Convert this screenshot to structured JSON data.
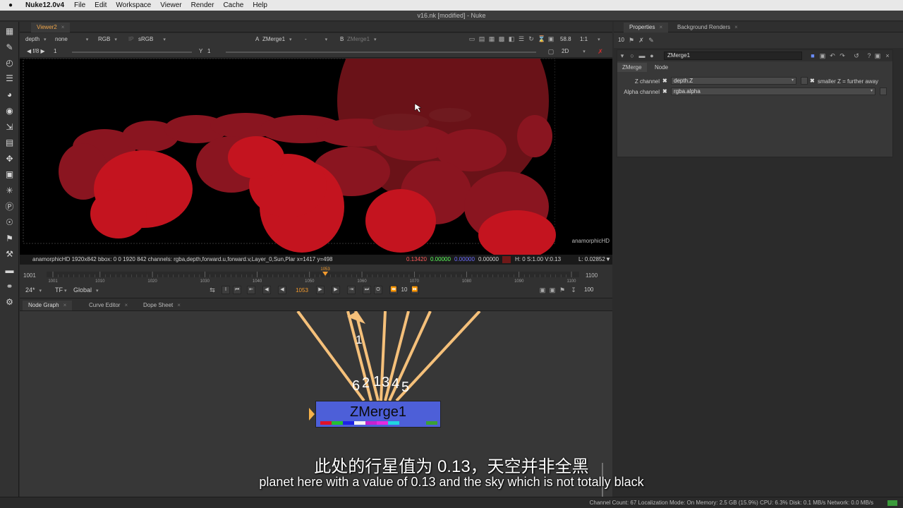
{
  "menubar": {
    "app": "Nuke12.0v4",
    "items": [
      "File",
      "Edit",
      "Workspace",
      "Viewer",
      "Render",
      "Cache",
      "Help"
    ]
  },
  "window_title": "v16.nk [modified] - Nuke",
  "viewer": {
    "tab": "Viewer2",
    "channel_set": "depth",
    "alpha_channel": "none",
    "display": "RGB",
    "colorspace": "sRGB",
    "input_a_label": "A",
    "input_a": "ZMerge1",
    "input_a_op": "-",
    "input_b_label": "B",
    "input_b": "ZMerge1",
    "zoom": "58.8",
    "proxy": "1:1",
    "mode": "2D",
    "fstop": "f/8",
    "gain": "1",
    "gamma_label": "Y",
    "gamma": "1",
    "format_label": "anamorphicHD"
  },
  "infobar": {
    "text": "anamorphicHD 1920x842  bbox: 0 0 1920 842 channels: rgba,depth,forward.u,forward.v,Layer_0,Sun,Plar  x=1417 y=498",
    "r": "0.13420",
    "g": "0.00000",
    "b": "0.00000",
    "a": "0.00000",
    "hsv": "H:   0 S:1.00 V:0.13",
    "lum": "L: 0.02852",
    "swatch_color": "#701818"
  },
  "timeline": {
    "start": "1001",
    "end": "1100",
    "current": "1053",
    "ticks": [
      "1001",
      "1010",
      "1020",
      "1030",
      "1040",
      "1050",
      "1060",
      "1070",
      "1080",
      "1090",
      "1100"
    ],
    "fps": "24*",
    "tf": "TF",
    "range_mode": "Global",
    "frame": "1053",
    "increment": "10",
    "end_field": "100"
  },
  "panels": {
    "node_graph": "Node Graph",
    "curve_editor": "Curve Editor",
    "dope_sheet": "Dope Sheet",
    "properties": "Properties",
    "background_renders": "Background Renders"
  },
  "node_graph": {
    "node_name": "ZMerge1",
    "edge_labels": [
      "1",
      "6",
      "2",
      "1",
      "3",
      "4",
      "5"
    ],
    "swatches": [
      "#e0122a",
      "#24c032",
      "#1d22e6",
      "#f3f3f3",
      "#c622cf",
      "#e52ae0",
      "#20d6e0"
    ]
  },
  "properties": {
    "max_panels": "10",
    "node_name": "ZMerge1",
    "tab_zmerge": "ZMerge",
    "tab_node": "Node",
    "z_channel_label": "Z channel",
    "z_channel_value": "depth.Z",
    "smaller_z_label": "smaller Z = further away",
    "alpha_channel_label": "Alpha channel",
    "alpha_channel_value": "rgba.alpha"
  },
  "statusbar": "Channel Count: 67  Localization Mode: On  Memory: 2.5 GB (15.9%)  CPU: 6.3%  Disk: 0.1 MB/s  Network: 0.0 MB/s",
  "subtitles": {
    "cn": "此处的行星值为 0.13，天空并非全黑",
    "en": "planet here with a value of 0.13 and the sky which is not totally black"
  }
}
